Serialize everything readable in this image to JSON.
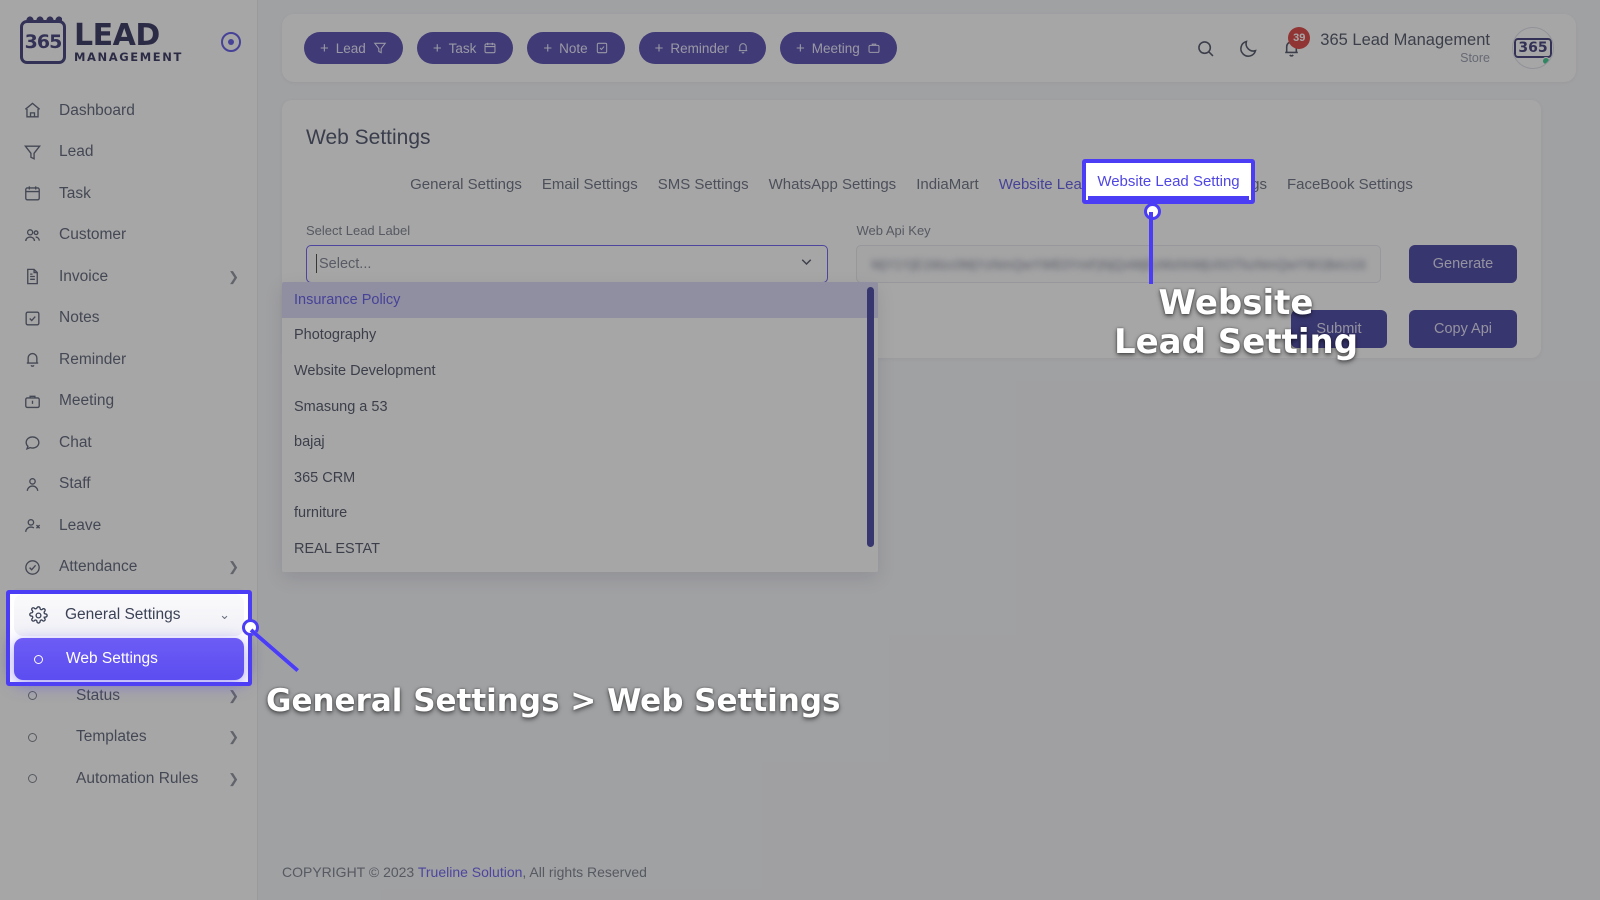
{
  "brand": {
    "logo_primary": "LEAD",
    "logo_badge": "365",
    "logo_secondary": "MANAGEMENT",
    "accent": "#4f46e5",
    "dark_accent": "#35309a",
    "pink": "#d6206b"
  },
  "sidebar": {
    "items": [
      {
        "label": "Dashboard",
        "icon": "home-icon",
        "has_chevron": false
      },
      {
        "label": "Lead",
        "icon": "funnel-icon",
        "has_chevron": false
      },
      {
        "label": "Task",
        "icon": "calendar-icon",
        "has_chevron": false
      },
      {
        "label": "Customer",
        "icon": "users-icon",
        "has_chevron": false
      },
      {
        "label": "Invoice",
        "icon": "document-icon",
        "has_chevron": true
      },
      {
        "label": "Notes",
        "icon": "note-check-icon",
        "has_chevron": false
      },
      {
        "label": "Reminder",
        "icon": "bell-icon",
        "has_chevron": false
      },
      {
        "label": "Meeting",
        "icon": "briefcase-icon",
        "has_chevron": false
      },
      {
        "label": "Chat",
        "icon": "chat-bubble-icon",
        "has_chevron": false
      },
      {
        "label": "Staff",
        "icon": "user-icon",
        "has_chevron": false
      },
      {
        "label": "Leave",
        "icon": "user-remove-icon",
        "has_chevron": false
      },
      {
        "label": "Attendance",
        "icon": "check-circle-icon",
        "has_chevron": true
      }
    ],
    "general_settings": {
      "label": "General Settings",
      "icon": "gear-icon",
      "chevron": "chevron-down-icon",
      "expanded": true
    },
    "sub_items": [
      {
        "label": "Web Settings",
        "active": true,
        "has_chevron": false
      },
      {
        "label": "Status",
        "active": false,
        "has_chevron": true
      },
      {
        "label": "Templates",
        "active": false,
        "has_chevron": true
      },
      {
        "label": "Automation Rules",
        "active": false,
        "has_chevron": true
      }
    ]
  },
  "topbar": {
    "quick_actions": [
      {
        "label": "Lead",
        "plus": "+",
        "icon": "funnel-icon"
      },
      {
        "label": "Task",
        "plus": "+",
        "icon": "calendar-icon"
      },
      {
        "label": "Note",
        "plus": "+",
        "icon": "note-check-icon"
      },
      {
        "label": "Reminder",
        "plus": "+",
        "icon": "bell-icon"
      },
      {
        "label": "Meeting",
        "plus": "+",
        "icon": "briefcase-icon"
      }
    ],
    "search_icon": "search-icon",
    "theme_icon": "moon-icon",
    "notification_icon": "bell-icon",
    "notification_count": "39",
    "account_name": "365 Lead Management",
    "account_role": "Store",
    "avatar_text": "365"
  },
  "page": {
    "title": "Web Settings",
    "tabs": [
      {
        "label": "General Settings",
        "active": false
      },
      {
        "label": "Email Settings",
        "active": false
      },
      {
        "label": "SMS Settings",
        "active": false
      },
      {
        "label": "WhatsApp Settings",
        "active": false
      },
      {
        "label": "IndiaMart",
        "active": false
      },
      {
        "label": "Website Lead Setting",
        "active": true
      },
      {
        "label": "Invoice Settings",
        "active": false
      },
      {
        "label": "FaceBook Settings",
        "active": false
      }
    ],
    "form": {
      "lead_label_label": "Select Lead Label",
      "lead_label_placeholder": "Select...",
      "lead_label_value": "",
      "api_key_label": "Web Api Key",
      "api_key_value": "MjY1YjE1Mzc0MjYzNmQwYWE0YmFjNjQxMjEzMzhhMjU0OTkzNmQwYW1BeU16",
      "generate_label": "Generate",
      "submit_label": "Submit",
      "copy_api_label": "Copy Api"
    },
    "dropdown": {
      "open": true,
      "options": [
        {
          "label": "Insurance Policy",
          "selected": true
        },
        {
          "label": "Photography",
          "selected": false
        },
        {
          "label": "Website Development",
          "selected": false
        },
        {
          "label": "Smasung a 53",
          "selected": false
        },
        {
          "label": "bajaj",
          "selected": false
        },
        {
          "label": "365 CRM",
          "selected": false
        },
        {
          "label": "furniture",
          "selected": false
        },
        {
          "label": "REAL ESTAT",
          "selected": false
        }
      ]
    }
  },
  "footer": {
    "prefix": "COPYRIGHT © 2023 ",
    "link": "Trueline Solution",
    "suffix": ", All rights Reserved"
  },
  "annotations": {
    "callout_sidebar": "General Settings > Web Settings",
    "callout_tab_line1": "Website",
    "callout_tab_line2": "Lead Setting"
  }
}
